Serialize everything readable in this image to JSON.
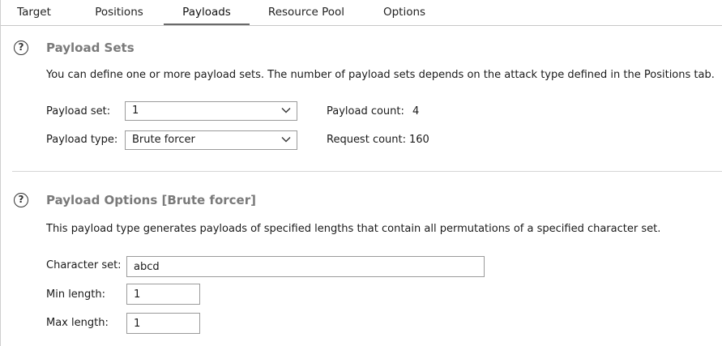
{
  "tabs": [
    {
      "label": "Target"
    },
    {
      "label": "Positions"
    },
    {
      "label": "Payloads"
    },
    {
      "label": "Resource Pool"
    },
    {
      "label": "Options"
    }
  ],
  "active_tab": "Payloads",
  "payload_sets": {
    "title": "Payload Sets",
    "description": "You can define one or more payload sets. The number of payload sets depends on the attack type defined in the Positions tab.",
    "payload_set_label": "Payload set:",
    "payload_set_value": "1",
    "payload_type_label": "Payload type:",
    "payload_type_value": "Brute forcer",
    "payload_count_label": "Payload count:",
    "payload_count_value": "4",
    "request_count_label": "Request count:",
    "request_count_value": "160"
  },
  "payload_options": {
    "title": "Payload Options [Brute forcer]",
    "description": "This payload type generates payloads of specified lengths that contain all permutations of a specified character set.",
    "character_set_label": "Character set:",
    "character_set_value": "abcd",
    "min_length_label": "Min length:",
    "min_length_value": "1",
    "max_length_label": "Max length:",
    "max_length_value": "1"
  },
  "icons": {
    "help": "question-circle-icon",
    "dropdown": "chevron-down-icon"
  },
  "colors": {
    "section_title": "#7a7a7a",
    "border": "#9a9a9a",
    "active_tab_underline": "#6a6a6a"
  }
}
